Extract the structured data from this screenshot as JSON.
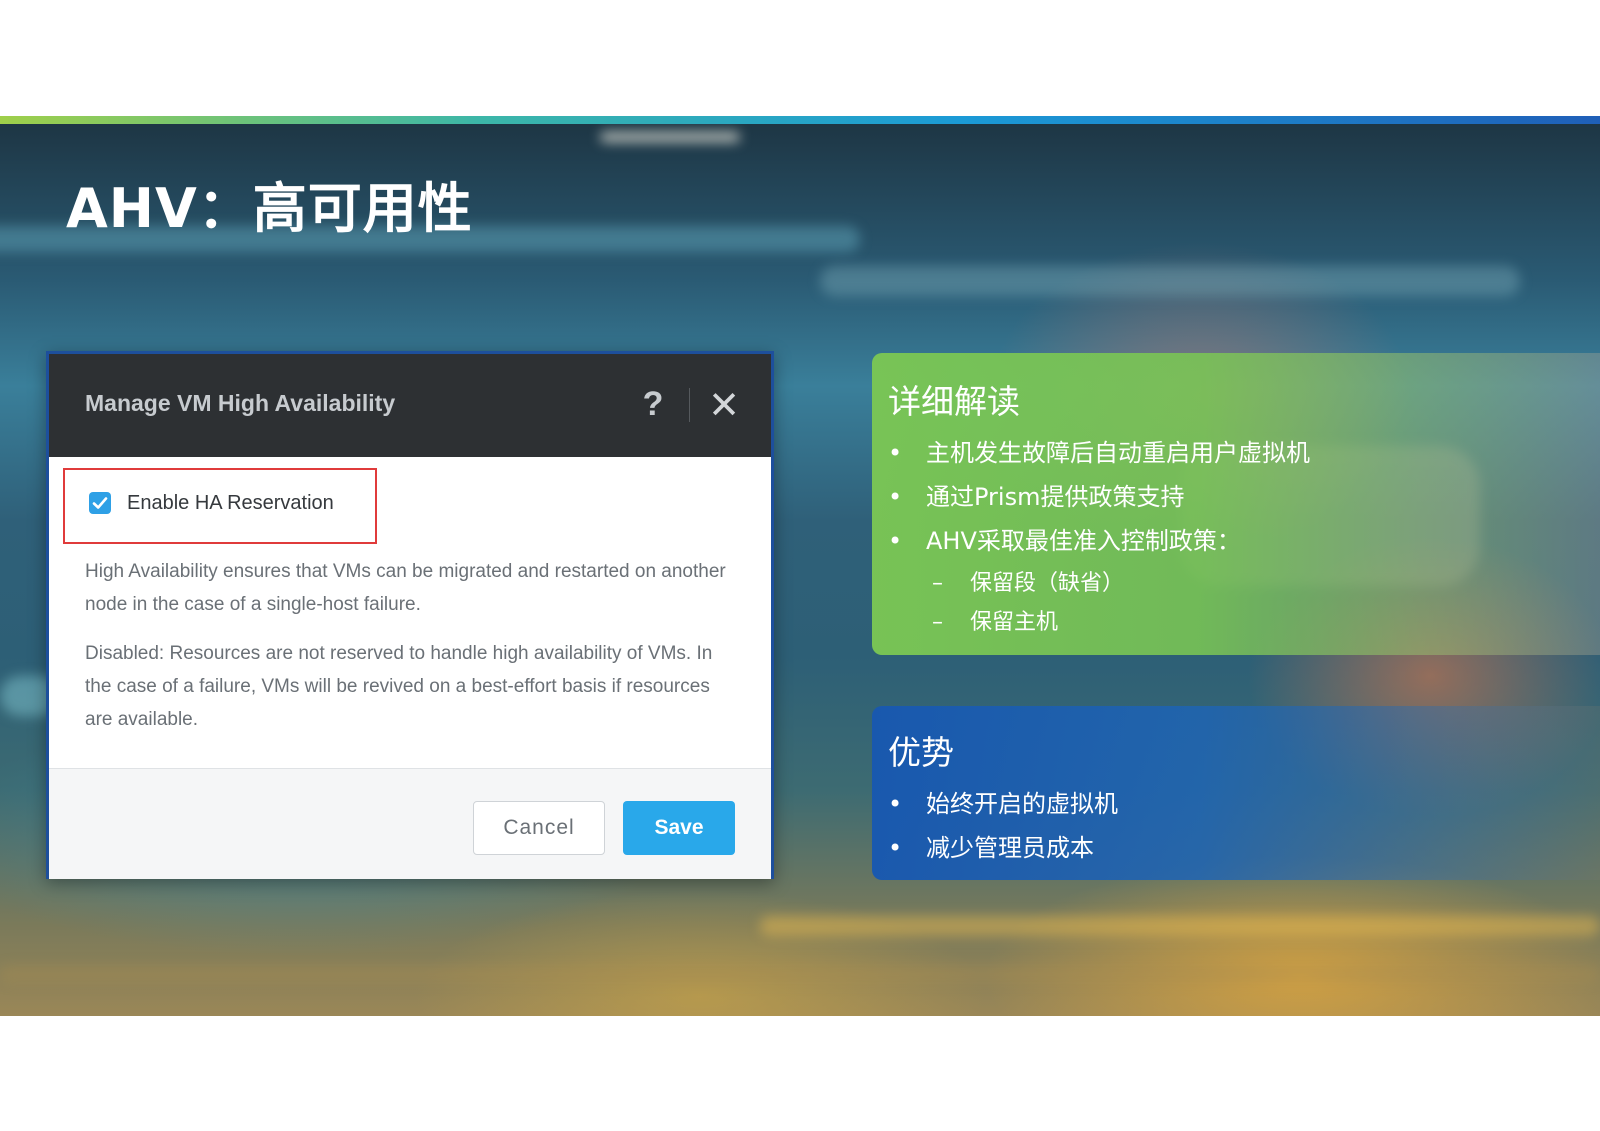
{
  "slide": {
    "title": "AHV：高可用性"
  },
  "dialog": {
    "title": "Manage VM High Availability",
    "help_label": "?",
    "close_label": "✕",
    "checkbox_label": "Enable HA Reservation",
    "checkbox_checked": true,
    "description_1": "High Availability ensures that VMs can be migrated and restarted on another node in the case of a single-host failure.",
    "description_2": "Disabled: Resources are not reserved to handle high availability of VMs. In the case of a failure, VMs will be revived on a best-effort basis if resources are available.",
    "cancel_label": "Cancel",
    "save_label": "Save"
  },
  "details_panel": {
    "heading": "详细解读",
    "bullets": [
      "主机发生故障后自动重启用户虚拟机",
      "通过Prism提供政策支持",
      "AHV采取最佳准入控制政策："
    ],
    "sub_items": [
      "保留段（缺省）",
      "保留主机"
    ]
  },
  "advantages_panel": {
    "heading": "优势",
    "bullets": [
      "始终开启的虚拟机",
      "减少管理员成本"
    ]
  },
  "colors": {
    "accent_blue": "#29a8ea",
    "dialog_header": "#2d3033",
    "highlight_red": "#e03b3b",
    "panel_green": "#7ac654",
    "panel_blue": "#1858b0"
  }
}
